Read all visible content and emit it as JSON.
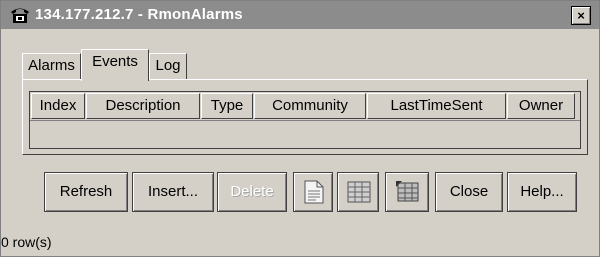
{
  "window": {
    "title": "134.177.212.7 - RmonAlarms",
    "close_label": "×"
  },
  "tabs": [
    {
      "label": "Alarms"
    },
    {
      "label": "Events"
    },
    {
      "label": "Log"
    }
  ],
  "table": {
    "columns": [
      "Index",
      "Description",
      "Type",
      "Community",
      "LastTimeSent",
      "Owner"
    ],
    "rows": []
  },
  "buttons": {
    "refresh": "Refresh",
    "insert": "Insert...",
    "delete": "Delete",
    "close": "Close",
    "help": "Help..."
  },
  "icon_buttons": [
    "copy-icon",
    "grid-icon",
    "export-icon"
  ],
  "status": "0 row(s)",
  "active_tab": "Events"
}
